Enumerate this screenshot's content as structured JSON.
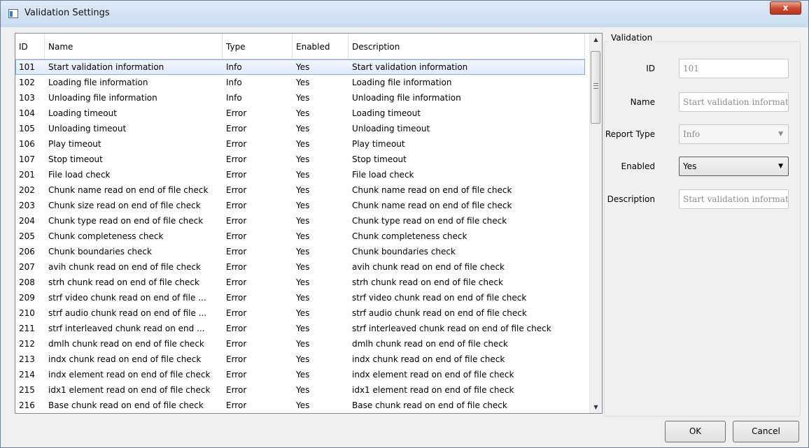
{
  "window": {
    "title": "Validation Settings",
    "close_label": "x"
  },
  "grid": {
    "columns": {
      "id": "ID",
      "name": "Name",
      "type": "Type",
      "enabled": "Enabled",
      "description": "Description"
    },
    "rows": [
      [
        "101",
        "Start validation information",
        "Info",
        "Yes",
        "Start validation information"
      ],
      [
        "102",
        "Loading file information",
        "Info",
        "Yes",
        "Loading file information"
      ],
      [
        "103",
        "Unloading file information",
        "Info",
        "Yes",
        "Unloading file information"
      ],
      [
        "104",
        "Loading timeout",
        "Error",
        "Yes",
        "Loading timeout"
      ],
      [
        "105",
        "Unloading timeout",
        "Error",
        "Yes",
        "Unloading timeout"
      ],
      [
        "106",
        "Play timeout",
        "Error",
        "Yes",
        "Play timeout"
      ],
      [
        "107",
        "Stop timeout",
        "Error",
        "Yes",
        "Stop timeout"
      ],
      [
        "201",
        "File load check",
        "Error",
        "Yes",
        "File load check"
      ],
      [
        "202",
        "Chunk name read on end of file check",
        "Error",
        "Yes",
        "Chunk name read on end of file check"
      ],
      [
        "203",
        "Chunk size read on end of file check",
        "Error",
        "Yes",
        "Chunk name read on end of file check"
      ],
      [
        "204",
        "Chunk type read on end of file check",
        "Error",
        "Yes",
        "Chunk type read on end of file check"
      ],
      [
        "205",
        "Chunk completeness check",
        "Error",
        "Yes",
        "Chunk completeness check"
      ],
      [
        "206",
        "Chunk boundaries check",
        "Error",
        "Yes",
        "Chunk boundaries check"
      ],
      [
        "207",
        "avih chunk read on end of file check",
        "Error",
        "Yes",
        "avih chunk read on end of file check"
      ],
      [
        "208",
        "strh chunk read on end of file check",
        "Error",
        "Yes",
        "strh chunk read on end of file check"
      ],
      [
        "209",
        "strf video chunk read on end of file ...",
        "Error",
        "Yes",
        "strf video chunk read on end of file check"
      ],
      [
        "210",
        "strf audio chunk read on end of file ...",
        "Error",
        "Yes",
        "strf audio chunk read on end of file check"
      ],
      [
        "211",
        "strf interleaved chunk read on end ...",
        "Error",
        "Yes",
        "strf interleaved chunk read on end of file check"
      ],
      [
        "212",
        "dmlh chunk read on end of file check",
        "Error",
        "Yes",
        "dmlh chunk read on end of file check"
      ],
      [
        "213",
        "indx chunk read on end of file check",
        "Error",
        "Yes",
        "indx chunk read on end of file check"
      ],
      [
        "214",
        "indx element read on end of file check",
        "Error",
        "Yes",
        "indx element read on end of file check"
      ],
      [
        "215",
        "idx1 element read on end of file check",
        "Error",
        "Yes",
        "idx1 element read on end of file check"
      ],
      [
        "216",
        "Base chunk read on end of file check",
        "Error",
        "Yes",
        "Base chunk read on end of file check"
      ]
    ],
    "selected_index": 0,
    "scroll": {
      "up_icon": "▲",
      "down_icon": "▼"
    }
  },
  "validation": {
    "group_title": "Validation",
    "id_label": "ID",
    "id_value": "101",
    "name_label": "Name",
    "name_value": "Start validation informat",
    "report_type_label": "Report Type",
    "report_type_value": "Info",
    "enabled_label": "Enabled",
    "enabled_value": "Yes",
    "description_label": "Description",
    "description_value": "Start validation informat",
    "dropdown_icon": "▼"
  },
  "buttons": {
    "ok": "OK",
    "cancel": "Cancel"
  }
}
